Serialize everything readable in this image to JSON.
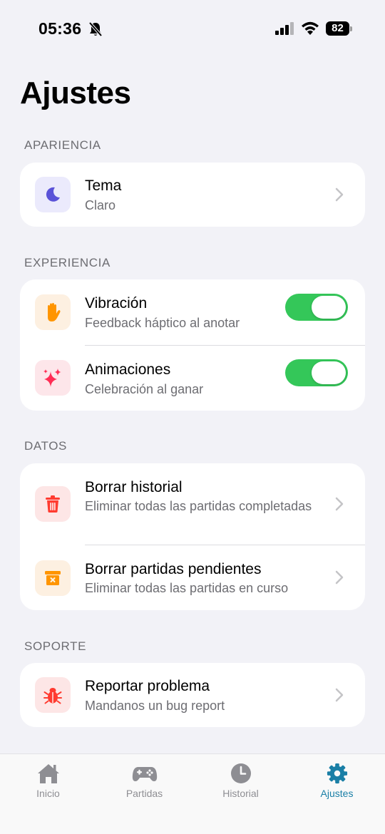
{
  "status_bar": {
    "time": "05:36",
    "battery": "82"
  },
  "page": {
    "title": "Ajustes"
  },
  "sections": {
    "apariencia": {
      "header": "APARIENCIA",
      "tema": {
        "title": "Tema",
        "subtitle": "Claro",
        "icon": "moon-icon"
      }
    },
    "experiencia": {
      "header": "EXPERIENCIA",
      "vibracion": {
        "title": "Vibración",
        "subtitle": "Feedback háptico al anotar",
        "enabled": true,
        "icon": "hand-icon"
      },
      "animaciones": {
        "title": "Animaciones",
        "subtitle": "Celebración al ganar",
        "enabled": true,
        "icon": "sparkles-icon"
      }
    },
    "datos": {
      "header": "DATOS",
      "borrar_historial": {
        "title": "Borrar historial",
        "subtitle": "Eliminar todas las partidas completadas",
        "icon": "trash-icon"
      },
      "borrar_pendientes": {
        "title": "Borrar partidas pendientes",
        "subtitle": "Eliminar todas las partidas en curso",
        "icon": "archive-x-icon"
      }
    },
    "soporte": {
      "header": "SOPORTE",
      "reportar": {
        "title": "Reportar problema",
        "subtitle": "Mandanos un bug report",
        "icon": "bug-icon"
      }
    }
  },
  "tabs": [
    {
      "label": "Inicio",
      "icon": "home-icon"
    },
    {
      "label": "Partidas",
      "icon": "gamepad-icon"
    },
    {
      "label": "Historial",
      "icon": "clock-icon"
    },
    {
      "label": "Ajustes",
      "icon": "gear-icon",
      "active": true
    }
  ],
  "colors": {
    "accent": "#1a7fa6",
    "toggle_on": "#34c759",
    "background": "#f2f2f7",
    "secondary_text": "#6d6d72"
  }
}
